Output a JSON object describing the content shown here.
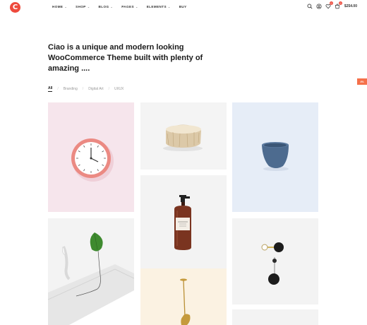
{
  "brand": {
    "logo_letter": "C"
  },
  "nav": {
    "items": [
      {
        "label": "HOME",
        "has_dropdown": true
      },
      {
        "label": "SHOP",
        "has_dropdown": true
      },
      {
        "label": "BLOG",
        "has_dropdown": true
      },
      {
        "label": "PAGES",
        "has_dropdown": true
      },
      {
        "label": "ELEMENTS",
        "has_dropdown": true
      },
      {
        "label": "BUY",
        "has_dropdown": false
      }
    ]
  },
  "header": {
    "wishlist_count": "0",
    "cart_count": "0",
    "cart_total": "$254.00"
  },
  "hero": {
    "headline": "Ciao is a unique and modern looking WooCommerce Theme built with plenty of amazing ...."
  },
  "filters": {
    "items": [
      "All",
      "Branding",
      "Digital Art",
      "UI/UX"
    ],
    "active": "All"
  },
  "side_tab": {
    "label": "4%"
  },
  "colors": {
    "accent": "#ee4a3c",
    "pink_tile": "#f6e5ec",
    "blue_tile": "#e6edf7",
    "cream_tile": "#fbf2e2",
    "gray_tile": "#f3f3f3"
  },
  "portfolio": {
    "items": [
      {
        "image": "wall-clock"
      },
      {
        "image": "wood-stump"
      },
      {
        "image": "blue-bowl"
      },
      {
        "image": "leaf-sculpture"
      },
      {
        "image": "amber-bottle"
      },
      {
        "image": "wall-hooks"
      },
      {
        "image": "brass-lamp"
      },
      {
        "image": "gray-tile"
      }
    ]
  }
}
